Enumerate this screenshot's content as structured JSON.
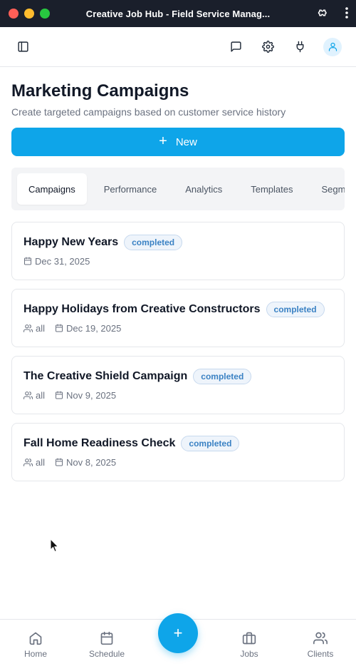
{
  "window": {
    "title": "Creative Job Hub - Field Service Manag..."
  },
  "page": {
    "title": "Marketing Campaigns",
    "subtitle": "Create targeted campaigns based on customer service history",
    "new_button_label": "New",
    "new_button_icon": "+"
  },
  "tabs": [
    {
      "label": "Campaigns",
      "active": true
    },
    {
      "label": "Performance",
      "active": false
    },
    {
      "label": "Analytics",
      "active": false
    },
    {
      "label": "Templates",
      "active": false
    },
    {
      "label": "Segm",
      "active": false
    }
  ],
  "campaigns": [
    {
      "name": "Happy New Years",
      "status": "completed",
      "audience": "",
      "date": "Dec 31, 2025"
    },
    {
      "name": "Happy Holidays from Creative Constructors",
      "status": "completed",
      "audience": "all",
      "date": "Dec 19, 2025"
    },
    {
      "name": "The Creative Shield Campaign",
      "status": "completed",
      "audience": "all",
      "date": "Nov 9, 2025"
    },
    {
      "name": "Fall Home Readiness Check",
      "status": "completed",
      "audience": "all",
      "date": "Nov 8, 2025"
    }
  ],
  "bottom_nav": {
    "home": "Home",
    "schedule": "Schedule",
    "fab": "+",
    "jobs": "Jobs",
    "clients": "Clients"
  },
  "colors": {
    "accent": "#0ea5e9",
    "badge_text": "#3b82c4",
    "badge_bg": "#eef4fb",
    "titlebar": "#1a1f2b"
  }
}
